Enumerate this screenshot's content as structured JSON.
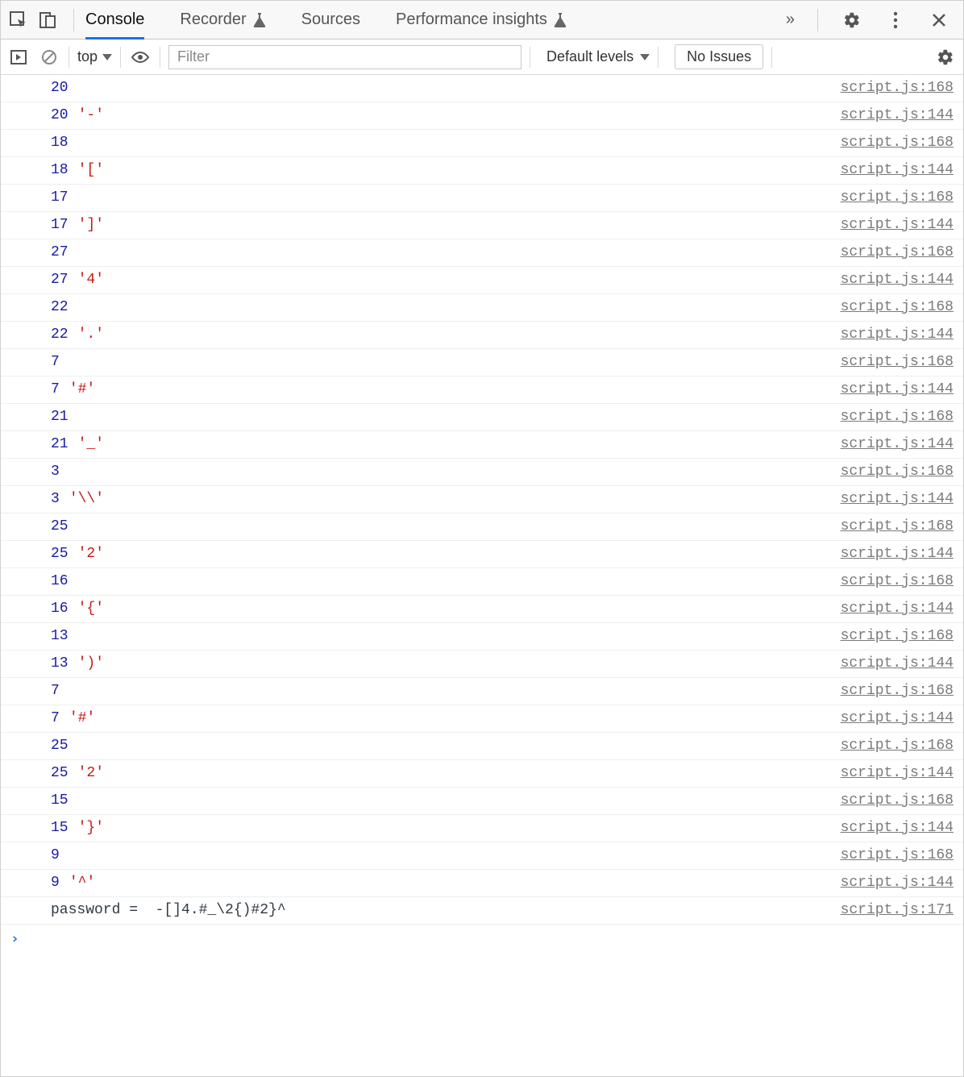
{
  "header": {
    "tabs": [
      {
        "label": "Console",
        "active": true,
        "beaker": false
      },
      {
        "label": "Recorder",
        "active": false,
        "beaker": true
      },
      {
        "label": "Sources",
        "active": false,
        "beaker": false
      },
      {
        "label": "Performance insights",
        "active": false,
        "beaker": true
      }
    ],
    "overflow_glyph": "»"
  },
  "filterbar": {
    "context_selector": "top",
    "filter_placeholder": "Filter",
    "levels_label": "Default levels",
    "issues_label": "No Issues"
  },
  "log_rows": [
    {
      "parts": [
        {
          "t": "num",
          "v": "20"
        }
      ],
      "src": "script.js:168"
    },
    {
      "parts": [
        {
          "t": "num",
          "v": "20"
        },
        {
          "t": "str",
          "v": "'-'"
        }
      ],
      "src": "script.js:144"
    },
    {
      "parts": [
        {
          "t": "num",
          "v": "18"
        }
      ],
      "src": "script.js:168"
    },
    {
      "parts": [
        {
          "t": "num",
          "v": "18"
        },
        {
          "t": "str",
          "v": "'['"
        }
      ],
      "src": "script.js:144"
    },
    {
      "parts": [
        {
          "t": "num",
          "v": "17"
        }
      ],
      "src": "script.js:168"
    },
    {
      "parts": [
        {
          "t": "num",
          "v": "17"
        },
        {
          "t": "str",
          "v": "']'"
        }
      ],
      "src": "script.js:144"
    },
    {
      "parts": [
        {
          "t": "num",
          "v": "27"
        }
      ],
      "src": "script.js:168"
    },
    {
      "parts": [
        {
          "t": "num",
          "v": "27"
        },
        {
          "t": "str",
          "v": "'4'"
        }
      ],
      "src": "script.js:144"
    },
    {
      "parts": [
        {
          "t": "num",
          "v": "22"
        }
      ],
      "src": "script.js:168"
    },
    {
      "parts": [
        {
          "t": "num",
          "v": "22"
        },
        {
          "t": "str",
          "v": "'.'"
        }
      ],
      "src": "script.js:144"
    },
    {
      "parts": [
        {
          "t": "num",
          "v": "7"
        }
      ],
      "src": "script.js:168"
    },
    {
      "parts": [
        {
          "t": "num",
          "v": "7"
        },
        {
          "t": "str",
          "v": "'#'"
        }
      ],
      "src": "script.js:144"
    },
    {
      "parts": [
        {
          "t": "num",
          "v": "21"
        }
      ],
      "src": "script.js:168"
    },
    {
      "parts": [
        {
          "t": "num",
          "v": "21"
        },
        {
          "t": "str",
          "v": "'_'"
        }
      ],
      "src": "script.js:144"
    },
    {
      "parts": [
        {
          "t": "num",
          "v": "3"
        }
      ],
      "src": "script.js:168"
    },
    {
      "parts": [
        {
          "t": "num",
          "v": "3"
        },
        {
          "t": "str",
          "v": "'\\\\'"
        }
      ],
      "src": "script.js:144"
    },
    {
      "parts": [
        {
          "t": "num",
          "v": "25"
        }
      ],
      "src": "script.js:168"
    },
    {
      "parts": [
        {
          "t": "num",
          "v": "25"
        },
        {
          "t": "str",
          "v": "'2'"
        }
      ],
      "src": "script.js:144"
    },
    {
      "parts": [
        {
          "t": "num",
          "v": "16"
        }
      ],
      "src": "script.js:168"
    },
    {
      "parts": [
        {
          "t": "num",
          "v": "16"
        },
        {
          "t": "str",
          "v": "'{'"
        }
      ],
      "src": "script.js:144"
    },
    {
      "parts": [
        {
          "t": "num",
          "v": "13"
        }
      ],
      "src": "script.js:168"
    },
    {
      "parts": [
        {
          "t": "num",
          "v": "13"
        },
        {
          "t": "str",
          "v": "')'"
        }
      ],
      "src": "script.js:144"
    },
    {
      "parts": [
        {
          "t": "num",
          "v": "7"
        }
      ],
      "src": "script.js:168"
    },
    {
      "parts": [
        {
          "t": "num",
          "v": "7"
        },
        {
          "t": "str",
          "v": "'#'"
        }
      ],
      "src": "script.js:144"
    },
    {
      "parts": [
        {
          "t": "num",
          "v": "25"
        }
      ],
      "src": "script.js:168"
    },
    {
      "parts": [
        {
          "t": "num",
          "v": "25"
        },
        {
          "t": "str",
          "v": "'2'"
        }
      ],
      "src": "script.js:144"
    },
    {
      "parts": [
        {
          "t": "num",
          "v": "15"
        }
      ],
      "src": "script.js:168"
    },
    {
      "parts": [
        {
          "t": "num",
          "v": "15"
        },
        {
          "t": "str",
          "v": "'}'"
        }
      ],
      "src": "script.js:144"
    },
    {
      "parts": [
        {
          "t": "num",
          "v": "9"
        }
      ],
      "src": "script.js:168"
    },
    {
      "parts": [
        {
          "t": "num",
          "v": "9"
        },
        {
          "t": "str",
          "v": "'^'"
        }
      ],
      "src": "script.js:144"
    },
    {
      "parts": [
        {
          "t": "plain",
          "v": "password =  -[]4.#_\\2{)#2}^"
        }
      ],
      "src": "script.js:171"
    }
  ],
  "prompt": "›"
}
